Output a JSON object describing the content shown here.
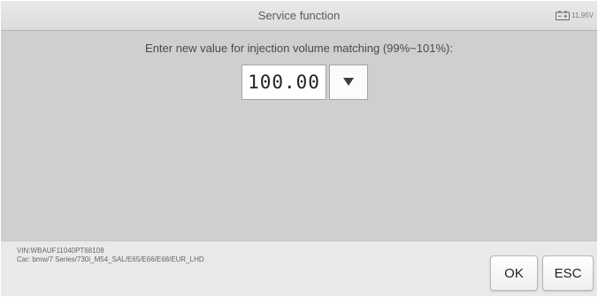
{
  "header": {
    "title": "Service function",
    "battery_voltage": "11.95V",
    "icon": "battery-icon"
  },
  "main": {
    "prompt": "Enter new value for injection volume matching (99%~101%):",
    "value": "100.00",
    "dropdown_icon": "triangle-down-icon"
  },
  "vehicle": {
    "vin_line": "VIN:WBAUF11040PT68108",
    "car_line": "Car: bmw/7 Series/730i_M54_SAL/E65/E66/E68/EUR_LHD"
  },
  "buttons": {
    "ok": "OK",
    "esc": "ESC"
  }
}
